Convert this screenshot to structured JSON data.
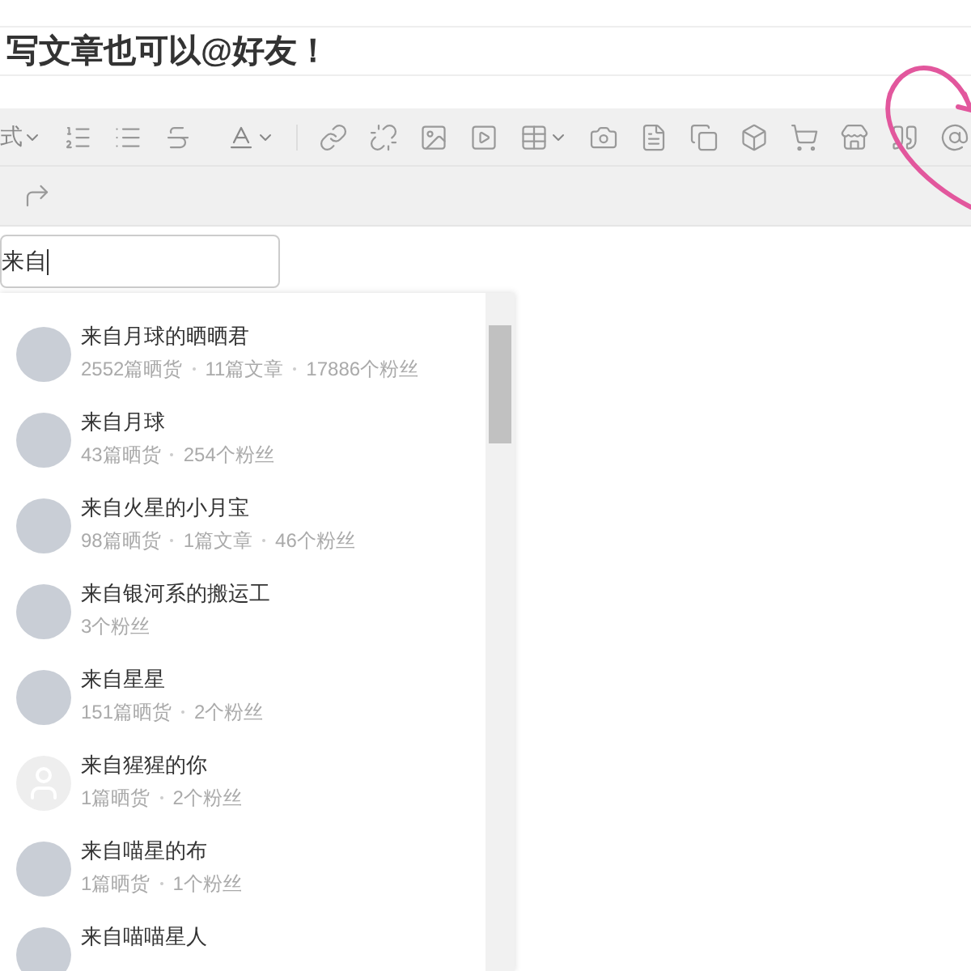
{
  "title": "写文章也可以@好友！",
  "toolbar": {
    "style_label": "式"
  },
  "mention_input": {
    "value": "来自"
  },
  "users": [
    {
      "name": "来自月球的晒晒君",
      "stats": [
        "2552篇晒货",
        "11篇文章",
        "17886个粉丝"
      ],
      "kind": "photo"
    },
    {
      "name": "来自月球",
      "stats": [
        "43篇晒货",
        "254个粉丝"
      ],
      "kind": "photo"
    },
    {
      "name": "来自火星的小月宝",
      "stats": [
        "98篇晒货",
        "1篇文章",
        "46个粉丝"
      ],
      "kind": "photo"
    },
    {
      "name": "来自银河系的搬运工",
      "stats": [
        "3个粉丝"
      ],
      "kind": "photo"
    },
    {
      "name": "来自星星",
      "stats": [
        "151篇晒货",
        "2个粉丝"
      ],
      "kind": "photo"
    },
    {
      "name": "来自猩猩的你",
      "stats": [
        "1篇晒货",
        "2个粉丝"
      ],
      "kind": "default"
    },
    {
      "name": "来自喵星的布",
      "stats": [
        "1篇晒货",
        "1个粉丝"
      ],
      "kind": "photo"
    },
    {
      "name": "来自喵喵星人",
      "kind": "photo"
    }
  ]
}
